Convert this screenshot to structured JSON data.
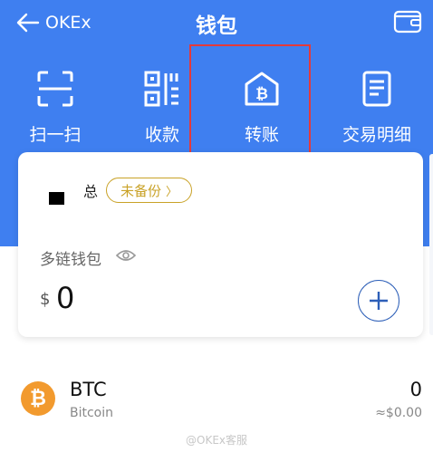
{
  "header": {
    "back_label": "OKEx",
    "title": "钱包"
  },
  "actions": [
    {
      "label": "扫一扫",
      "icon": "scan-icon"
    },
    {
      "label": "收款",
      "icon": "qr-code-icon"
    },
    {
      "label": "转账",
      "icon": "transfer-bitcoin-house-icon"
    },
    {
      "label": "交易明细",
      "icon": "transaction-details-icon"
    }
  ],
  "wallet_card": {
    "total_label": "总",
    "backup_badge": "未备份",
    "wallet_name": "多链钱包",
    "currency_symbol": "$",
    "balance": "0"
  },
  "assets": [
    {
      "symbol": "BTC",
      "name": "Bitcoin",
      "balance": "0",
      "fiat": "≈$0.00",
      "icon": "bitcoin-icon"
    }
  ],
  "watermark": "@OKEx客服",
  "colors": {
    "header_blue": "#3f7ff0",
    "badge_gold": "#c9a227",
    "bitcoin_orange": "#f29a2e",
    "highlight_red": "#e53a3a",
    "add_button_blue": "#2d5fb8"
  }
}
